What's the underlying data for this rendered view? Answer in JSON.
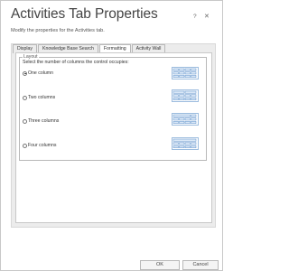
{
  "dialog": {
    "title": "Activities Tab Properties",
    "subtitle": "Modify the properties for the Activities tab.",
    "help_glyph": "?",
    "close_glyph": "✕"
  },
  "tabs": [
    {
      "label": "Display"
    },
    {
      "label": "Knowledge Base Search"
    },
    {
      "label": "Formatting"
    },
    {
      "label": "Activity Wall"
    }
  ],
  "active_tab": "Formatting",
  "layout": {
    "legend": "Layout",
    "instruction": "Select the number of columns the control occupies:",
    "options": [
      {
        "label": "One column",
        "selected": true
      },
      {
        "label": "Two columns",
        "selected": false
      },
      {
        "label": "Three columns",
        "selected": false
      },
      {
        "label": "Four columns",
        "selected": false
      }
    ]
  },
  "footer": {
    "ok_label": "OK",
    "cancel_label": "Cancel"
  },
  "colors": {
    "preview_stroke": "#5b8fc9",
    "preview_fill": "#dbe8f7"
  }
}
